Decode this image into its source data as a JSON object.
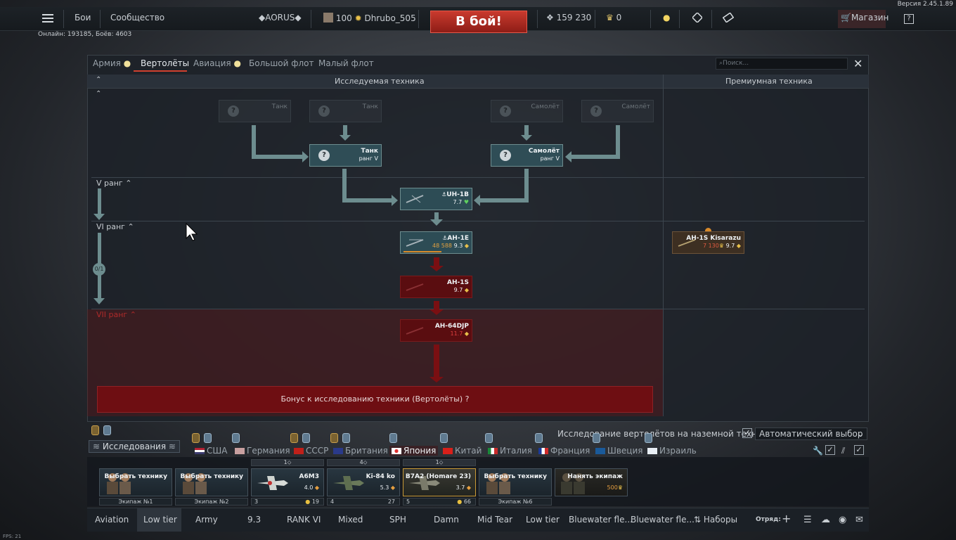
{
  "topbar": {
    "version": "Версия 2.45.1.89",
    "menu_icon": "hamburger-icon",
    "battles": "Бои",
    "community": "Сообщество",
    "squadron_tag": "◆AORUS◆",
    "level": "100",
    "player_name": "Dhrubo_505",
    "battle_button": "В бой!",
    "silver_lions": "159 230",
    "golden_eagles": "0",
    "shop": "Магазин",
    "help": "?",
    "online": "Онлайн: 193185, Боёв: 4603"
  },
  "panel": {
    "tabs": [
      {
        "label": "Армия"
      },
      {
        "label": "Вертолёты"
      },
      {
        "label": "Авиация"
      },
      {
        "label": "Большой флот"
      },
      {
        "label": "Малый флот"
      }
    ],
    "search_placeholder": "Поиск...",
    "close": "✕",
    "researched_header": "Исследуемая техника",
    "premium_header": "Премиумная техника",
    "ranks": {
      "v": "V ранг",
      "vi": "VI ранг",
      "vii": "VII ранг"
    },
    "progress_counter": "0/1",
    "bonus": "Бонус к исследованию техники (Вертолёты) ?"
  },
  "tree": {
    "locked1": {
      "label": "Танк"
    },
    "locked2": {
      "label": "Танк"
    },
    "locked3": {
      "label": "Самолёт"
    },
    "locked4": {
      "label": "Самолёт"
    },
    "group_tank": {
      "name": "Танк",
      "sub": "ранг V"
    },
    "group_plane": {
      "name": "Самолёт",
      "sub": "ранг V"
    },
    "uh1b": {
      "name": "UH-1B",
      "br": "7.7"
    },
    "ah1e": {
      "name": "AH-1E",
      "rp": "48 588",
      "br": "9.3"
    },
    "ah1s": {
      "name": "AH-1S",
      "br": "9.7"
    },
    "ah64djp": {
      "name": "AH-64DJP",
      "br": "11.7"
    },
    "premium_ah1s": {
      "name": "AH-1S Kisarazu",
      "price": "7 130",
      "br": "9.7"
    }
  },
  "nations": {
    "research_tab": "Исследования",
    "note": "Исследование вертолётов на наземной технике",
    "auto_select": "Автоматический выбор",
    "list": [
      {
        "label": "США"
      },
      {
        "label": "Германия"
      },
      {
        "label": "СССР"
      },
      {
        "label": "Британия"
      },
      {
        "label": "Япония"
      },
      {
        "label": "Китай"
      },
      {
        "label": "Италия"
      },
      {
        "label": "Франция"
      },
      {
        "label": "Швеция"
      },
      {
        "label": "Израиль"
      }
    ]
  },
  "slots": [
    {
      "title": "Выбрать технику",
      "foot": "Экипаж №1"
    },
    {
      "title": "Выбрать технику",
      "foot": "Экипаж №2"
    },
    {
      "title": "A6M3",
      "br": "4.0",
      "top": "1",
      "foot_left": "3",
      "foot_right": "19"
    },
    {
      "title": "Ki-84 ko",
      "br": "5.3",
      "top": "4",
      "foot_left": "4",
      "foot_right": "27"
    },
    {
      "title": "B7A2 (Homare 23)",
      "br": "3.7",
      "top": "1",
      "foot_left": "5",
      "foot_right": "66"
    },
    {
      "title": "Выбрать технику",
      "foot": "Экипаж №6"
    },
    {
      "title": "Нанять экипаж",
      "price": "500"
    }
  ],
  "presets": [
    "Aviation",
    "Low tier",
    "Army",
    "9.3",
    "RANK VI",
    "Mixed",
    "SPH",
    "Damn",
    "Mid Tear",
    "Low tier",
    "Bluewater fle...",
    "Bluewater fle...",
    "Наборы"
  ],
  "squad_label": "Отряд:",
  "fps": "FPS: 21"
}
